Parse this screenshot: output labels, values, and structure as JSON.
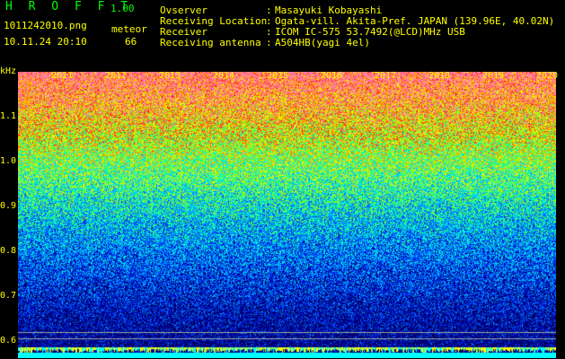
{
  "header": {
    "app_name": "H R O F F T",
    "version": "1.00",
    "filename": "1011242010.png",
    "datetime": "10.11.24 20:10",
    "meteor_label": "meteor",
    "meteor_count": "66",
    "fields": [
      {
        "label": "Ovserver",
        "value": "Masayuki Kobayashi"
      },
      {
        "label": "Receiving Location",
        "value": "Ogata-vill. Akita-Pref. JAPAN (139.96E, 40.02N)"
      },
      {
        "label": "Receiver",
        "value": "ICOM IC-575 53.7492(@LCD)MHz USB"
      },
      {
        "label": "Receiving antenna",
        "value": "A504HB(yagi 4el)"
      }
    ]
  },
  "spectrogram": {
    "y_unit": "kHz",
    "y_ticks": [
      "1.1",
      "1.0",
      "0.9",
      "0.8",
      "0.7",
      "0.6"
    ],
    "x_ticks": [
      "2011",
      "2012",
      "2013",
      "2014",
      "2015",
      "2016",
      "2017",
      "2018",
      "2019",
      "2020"
    ],
    "colors": {
      "axis_text": "#ffff00",
      "title": "#00ff00",
      "guide_line": "#9aa8a8",
      "baseline": "#00ffff"
    }
  }
}
